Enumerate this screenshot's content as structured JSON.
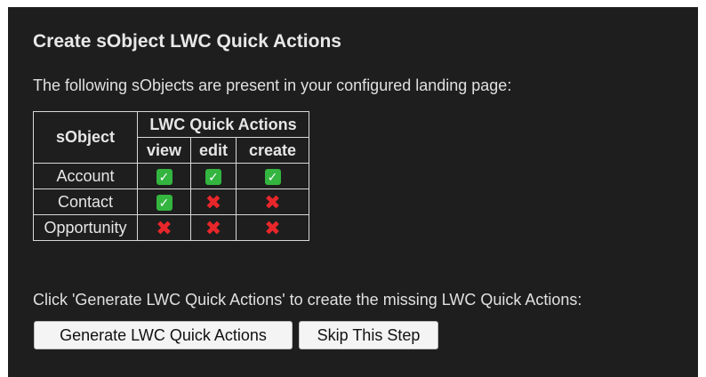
{
  "title": "Create sObject LWC Quick Actions",
  "intro": "The following sObjects are present in your configured landing page:",
  "table": {
    "sobject_header": "sObject",
    "group_header": "LWC Quick Actions",
    "action_headers": [
      "view",
      "edit",
      "create"
    ],
    "rows": [
      {
        "name": "Account",
        "status": [
          "present",
          "present",
          "present"
        ]
      },
      {
        "name": "Contact",
        "status": [
          "present",
          "missing",
          "missing"
        ]
      },
      {
        "name": "Opportunity",
        "status": [
          "missing",
          "missing",
          "missing"
        ]
      }
    ]
  },
  "prompt": "Click 'Generate LWC Quick Actions' to create the missing LWC Quick Actions:",
  "buttons": {
    "generate_label": "Generate LWC Quick Actions",
    "skip_label": "Skip This Step"
  },
  "icons": {
    "present": "green-checkmark-icon",
    "missing": "red-cross-icon"
  },
  "colors": {
    "background": "#1e1e1e",
    "check_green": "#33b540",
    "cross_red": "#e8272b"
  }
}
